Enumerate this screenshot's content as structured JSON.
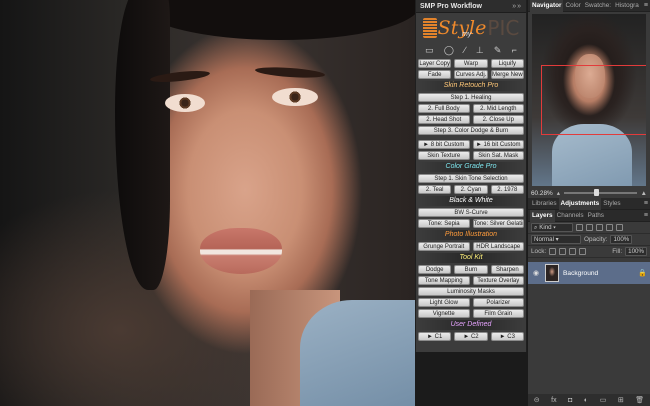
{
  "smp_panel": {
    "title": "SMP Pro Workflow",
    "controls": "»»",
    "logo": {
      "word1": "Style",
      "word2": "my",
      "word3": "PIC"
    },
    "tools": [
      "▭",
      "◯",
      "∕",
      "⊥",
      "✎",
      "⌐"
    ],
    "rows1": [
      [
        "Layer Copy",
        "Warp",
        "Liquify"
      ],
      [
        "Fade",
        "Curves Adj.",
        "Merge New"
      ]
    ],
    "skin_title": "Skin Retouch Pro",
    "skin_rows": [
      [
        "Step 1. Healing"
      ],
      [
        "2. Full Body",
        "2. Mid Length"
      ],
      [
        "2. Head Shot",
        "2. Close Up"
      ],
      [
        "Step 3. Color Dodge & Burn"
      ]
    ],
    "custom_rows": [
      [
        "► 8 bit Custom",
        "► 16 bit Custom"
      ],
      [
        "Skin Texture",
        "Skin Sat. Mask"
      ]
    ],
    "color_title": "Color Grade Pro",
    "color_rows": [
      [
        "Step 1. Skin Tone Selection"
      ],
      [
        "2. Teal",
        "2. Cyan",
        "2. 1978"
      ]
    ],
    "bw_title": "Black & White",
    "bw_rows": [
      [
        "BW S-Curve"
      ],
      [
        "Tone: Sepia",
        "Tone: Silver Gelatin"
      ]
    ],
    "photo_title": "Photo Illustration",
    "photo_rows": [
      [
        "Grunge Portrait",
        "HDR Landscape"
      ]
    ],
    "tool_title": "Tool Kit",
    "tool_rows": [
      [
        "Dodge",
        "Burn",
        "Sharpen"
      ],
      [
        "Tone Mapping",
        "Texture Overlay"
      ],
      [
        "Luminosity Masks"
      ],
      [
        "Light Glow",
        "Polarizer"
      ],
      [
        "Vignette",
        "Film Grain"
      ]
    ],
    "user_title": "User Defined",
    "user_rows": [
      [
        "► C1",
        "► C2",
        "► C3"
      ]
    ]
  },
  "section_colors": {
    "skin": "#ffc879",
    "color": "#7fe6ee",
    "bw": "#ffffff",
    "photo": "#ff9c3c",
    "tool": "#fff07a",
    "user": "#e6a3ff"
  },
  "navigator": {
    "tabs": [
      "Navigator",
      "Color",
      "Swatche:",
      "Histogra"
    ],
    "zoom": "60.28%",
    "menu": "≡"
  },
  "adjust": {
    "tabs": [
      "Libraries",
      "Adjustments",
      "Styles"
    ]
  },
  "layers": {
    "tabs": [
      "Layers",
      "Channels",
      "Paths"
    ],
    "kind": "Kind",
    "blend": "Normal",
    "opacity_label": "Opacity:",
    "opacity": "100%",
    "lock_label": "Lock:",
    "fill_label": "Fill:",
    "fill": "100%",
    "layer_name": "Background",
    "footer_icons": [
      "⊝",
      "fx",
      "◘",
      "◐",
      "▭",
      "⊞",
      "🗑"
    ]
  }
}
